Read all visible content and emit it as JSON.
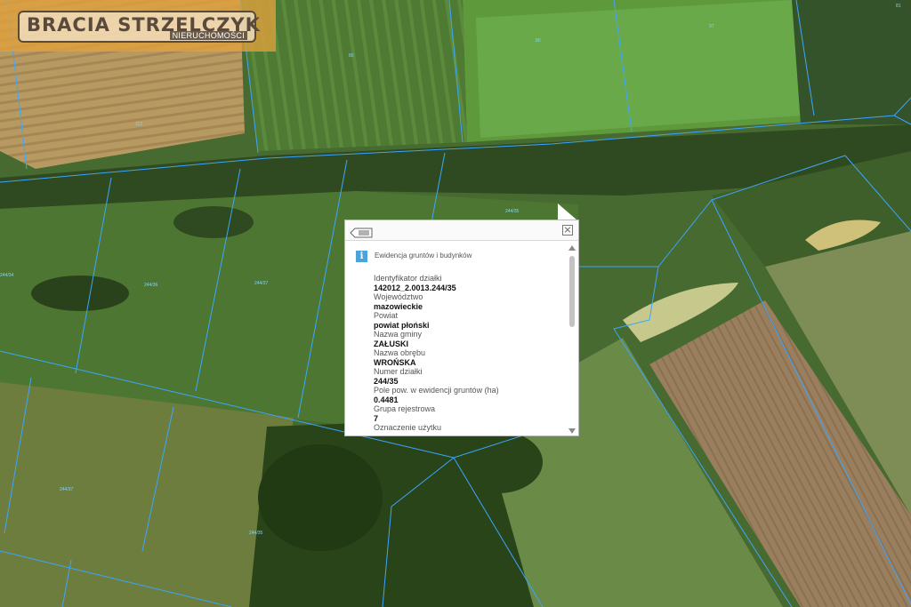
{
  "logo": {
    "main": "BRACIA STRZELCZYK",
    "sub": "NIERUCHOMOŚCI"
  },
  "parcel_labels": [
    "80",
    "80",
    "81",
    "97",
    "112",
    "244/35",
    "244/34",
    "244/36",
    "244/37",
    "244/37",
    "244/35"
  ],
  "popup": {
    "layer_title": "Ewidencja gruntów i budynków",
    "fields": [
      {
        "label": "Identyfikator działki",
        "value": "142012_2.0013.244/35"
      },
      {
        "label": "Województwo",
        "value": "mazowieckie"
      },
      {
        "label": "Powiat",
        "value": "powiat płoński"
      },
      {
        "label": "Nazwa gminy",
        "value": "ZAŁUSKI"
      },
      {
        "label": "Nazwa obrębu",
        "value": "WROŃSKA"
      },
      {
        "label": "Numer działki",
        "value": "244/35"
      },
      {
        "label": "Pole pow. w ewidencji gruntów (ha)",
        "value": "0.4481"
      },
      {
        "label": "Grupa rejestrowa",
        "value": "7"
      },
      {
        "label": "Oznaczenie użytku",
        "value": ""
      }
    ],
    "icons": {
      "list": "list-icon",
      "close": "close-icon",
      "info": "info-icon"
    }
  },
  "colors": {
    "parcel_line": "#3aa6ff",
    "logo_bg": "#e2a03c",
    "info": "#4ba3d8"
  }
}
